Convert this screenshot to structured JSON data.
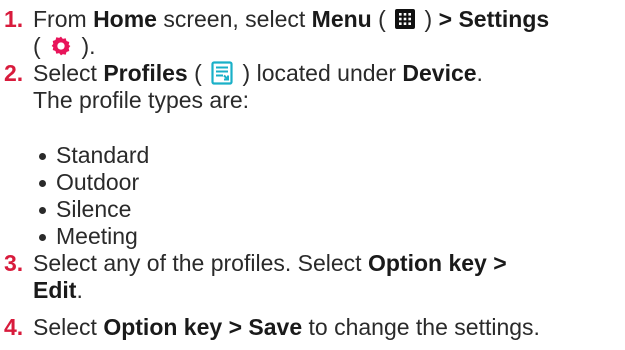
{
  "steps": [
    {
      "number": "1.",
      "line1": {
        "t1": "From ",
        "b1": "Home",
        "t2": " screen, select ",
        "b2": "Menu",
        "t3": " ( ",
        "t4": " ) ",
        "b3": "> Settings"
      },
      "line2": {
        "t1": "( ",
        "t2": " )."
      }
    },
    {
      "number": "2.",
      "line1": {
        "t1": "Select ",
        "b1": "Profiles",
        "t2": " ( ",
        "t3": " ) located under ",
        "b2": "Device",
        "t4": "."
      },
      "line2": "The profile types are:"
    },
    {
      "number": "3.",
      "line1": {
        "t1": "Select any of the profiles. Select ",
        "b1": "Option key >"
      },
      "line2": {
        "b1": "Edit",
        "t1": "."
      }
    },
    {
      "number": "4.",
      "line1": {
        "t1": "Select ",
        "b1": "Option key > Save",
        "t2": " to change the settings."
      }
    }
  ],
  "profile_types": [
    "Standard",
    "Outdoor",
    "Silence",
    "Meeting"
  ],
  "icons": {
    "menu": "menu-grid-icon",
    "settings": "settings-gear-icon",
    "profiles": "profiles-icon"
  },
  "colors": {
    "step_number": "#d81b3c",
    "gear": "#e8145a",
    "profiles_icon": "#1ab0c8",
    "text": "#2a2a2a"
  }
}
